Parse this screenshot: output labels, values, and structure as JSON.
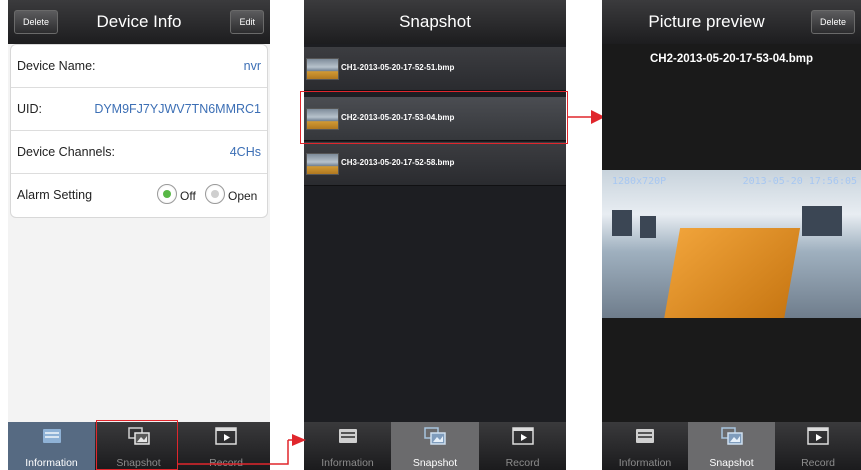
{
  "colors": {
    "accent": "#3c6fb5",
    "highlight": "#e0262c",
    "radio_on": "#58b846"
  },
  "device_info": {
    "title": "Device Info",
    "delete_label": "Delete",
    "edit_label": "Edit",
    "device_name": {
      "label": "Device Name:",
      "value": "nvr"
    },
    "uid": {
      "label": "UID:",
      "value": "DYM9FJ7YJWV7TN6MMRC1"
    },
    "channels": {
      "label": "Device Channels:",
      "value": "4CHs"
    },
    "alarm": {
      "label": "Alarm Setting",
      "off_label": "Off",
      "open_label": "Open",
      "selected": "Off"
    }
  },
  "snapshot": {
    "title": "Snapshot",
    "files": [
      "CH1-2013-05-20-17-52-51.bmp",
      "CH2-2013-05-20-17-53-04.bmp",
      "CH3-2013-05-20-17-52-58.bmp"
    ]
  },
  "preview": {
    "title": "Picture preview",
    "delete_label": "Delete",
    "file_name": "CH2-2013-05-20-17-53-04.bmp",
    "stamp_left": "1280x720P",
    "stamp_right": "2013-05-20 17:56:05"
  },
  "tabs": {
    "information": "Information",
    "snapshot": "Snapshot",
    "record": "Record",
    "icons": [
      "information-icon",
      "snapshot-icon",
      "record-icon"
    ]
  }
}
